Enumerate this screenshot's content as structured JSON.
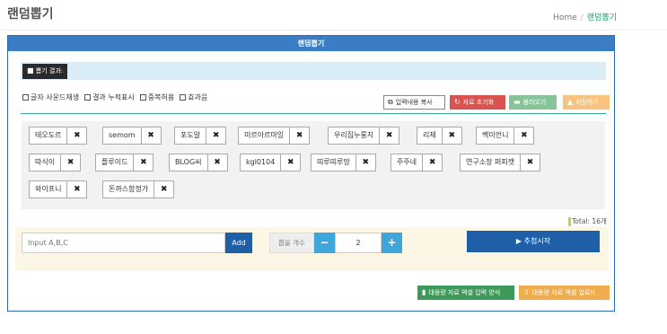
{
  "page": {
    "title": "랜덤뽑기",
    "breadcrumb": {
      "home": "Home",
      "separator": "/",
      "current": "랜덤뽑기"
    }
  },
  "panel": {
    "header": "랜덤뽑기",
    "result_label": "뽑기 결과:",
    "options": [
      {
        "label": "글자 사운드재생",
        "checked": false
      },
      {
        "label": "결과 누적표시",
        "checked": false
      },
      {
        "label": "중복허용",
        "checked": false
      },
      {
        "label": "효과음",
        "checked": false
      }
    ],
    "buttons": {
      "copy": "입력내용 복사",
      "reset": "자료 초기화",
      "load": "불러오기",
      "save": "저장하기"
    },
    "items": [
      "테오도르",
      "semom",
      "포도알",
      "미르아르마잉",
      "우리집누룽지",
      "리제",
      "백미언니",
      "따식이",
      "플루이드",
      "BLOG씨",
      "kgl0104",
      "띠루띠루망",
      "주주네",
      "연구소장 퍼피캣",
      "와이프니",
      "돈까스함정가"
    ],
    "total": "Total: 16개",
    "input": {
      "placeholder": "Input A,B,C",
      "add_label": "Add"
    },
    "count": {
      "label": "뽑을 개수",
      "minus": "−",
      "value": "2",
      "plus": "+"
    },
    "start_label": "추첨시작",
    "excel_form": "대용량 자료 엑셀 입력 양식",
    "excel_upload": "대용량 자료 엑셀 업로드"
  },
  "colors": {
    "header": "#3a7dc4",
    "reset": "#d9534f",
    "load": "#88c49a",
    "save": "#f7c37e",
    "primary": "#1f5fa8",
    "stepper": "#3fa6dc",
    "excel_form": "#3d9a58",
    "excel_upload": "#f0ad4e"
  }
}
